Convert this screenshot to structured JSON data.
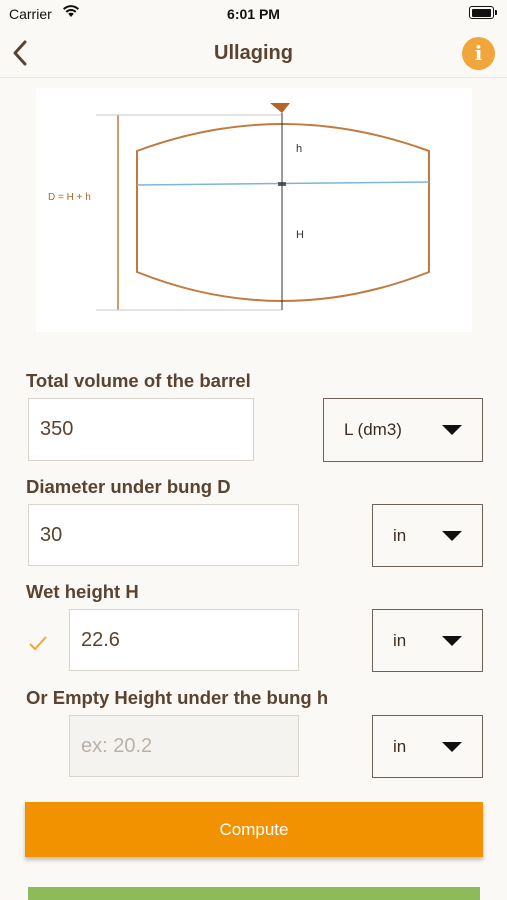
{
  "status_bar": {
    "carrier": "Carrier",
    "time": "6:01 PM"
  },
  "nav": {
    "title": "Ullaging",
    "back_icon": "chevron-left-icon",
    "info_icon": "info-icon"
  },
  "diagram": {
    "formula": "D = H + h",
    "upper_label": "h",
    "lower_label": "H"
  },
  "fields": {
    "total_volume": {
      "label": "Total volume of the barrel",
      "value": "350",
      "unit": "L (dm3)"
    },
    "diameter": {
      "label": "Diameter under bung D",
      "value": "30",
      "unit": "in"
    },
    "wet_height": {
      "label": "Wet height H",
      "value": "22.6",
      "unit": "in"
    },
    "empty_height": {
      "label": "Or Empty Height under the bung h",
      "value": "",
      "placeholder": "ex: 20.2",
      "unit": "in"
    }
  },
  "compute_label": "Compute",
  "colors": {
    "accent": "#f39200",
    "info": "#f0a63a",
    "text": "#5b4331",
    "barrel": "#c27a3f",
    "liquid_line": "#7ab8d4",
    "green": "#8dbb5a"
  }
}
